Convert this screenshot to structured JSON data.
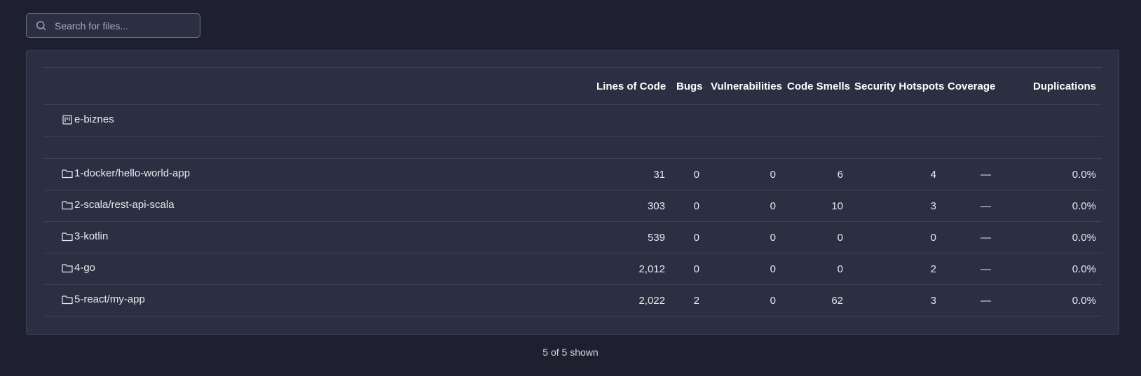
{
  "search": {
    "placeholder": "Search for files..."
  },
  "table": {
    "columns": [
      "Lines of Code",
      "Bugs",
      "Vulnerabilities",
      "Code Smells",
      "Security Hotspots",
      "Coverage",
      "Duplications"
    ],
    "project": {
      "name": "e-biznes",
      "icon": "project-icon"
    },
    "rows": [
      {
        "name": "1-docker/hello-world-app",
        "icon": "folder-icon",
        "loc": "31",
        "bugs": "0",
        "vulnerabilities": "0",
        "code_smells": "6",
        "security_hotspots": "4",
        "coverage": "—",
        "duplications": "0.0%"
      },
      {
        "name": "2-scala/rest-api-scala",
        "icon": "folder-icon",
        "loc": "303",
        "bugs": "0",
        "vulnerabilities": "0",
        "code_smells": "10",
        "security_hotspots": "3",
        "coverage": "—",
        "duplications": "0.0%"
      },
      {
        "name": "3-kotlin",
        "icon": "folder-icon",
        "loc": "539",
        "bugs": "0",
        "vulnerabilities": "0",
        "code_smells": "0",
        "security_hotspots": "0",
        "coverage": "—",
        "duplications": "0.0%"
      },
      {
        "name": "4-go",
        "icon": "folder-icon",
        "loc": "2,012",
        "bugs": "0",
        "vulnerabilities": "0",
        "code_smells": "0",
        "security_hotspots": "2",
        "coverage": "—",
        "duplications": "0.0%"
      },
      {
        "name": "5-react/my-app",
        "icon": "folder-icon",
        "loc": "2,022",
        "bugs": "2",
        "vulnerabilities": "0",
        "code_smells": "62",
        "security_hotspots": "3",
        "coverage": "—",
        "duplications": "0.0%"
      }
    ]
  },
  "footer": {
    "shown_text": "5 of 5 shown"
  },
  "colors": {
    "background": "#1e2030",
    "card": "#2a2f42",
    "border": "#3e4357",
    "text": "#e8e9ee"
  }
}
